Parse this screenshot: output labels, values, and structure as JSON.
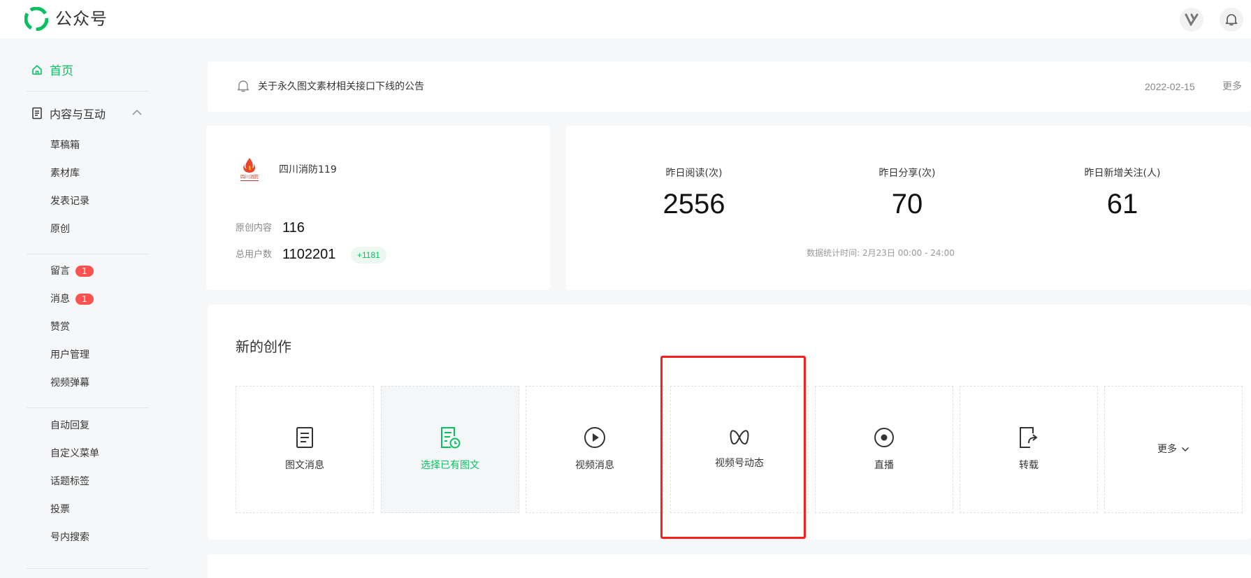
{
  "app": {
    "brand": "公众号"
  },
  "sidebar": {
    "home_label": "首页",
    "group_label": "内容与互动",
    "items_content": [
      "草稿箱",
      "素材库",
      "发表记录",
      "原创"
    ],
    "items_interact": [
      {
        "label": "留言",
        "badge": "1"
      },
      {
        "label": "消息",
        "badge": "1"
      },
      {
        "label": "赞赏"
      },
      {
        "label": "用户管理"
      },
      {
        "label": "视频弹幕"
      }
    ],
    "items_features": [
      "自动回复",
      "自定义菜单",
      "话题标签",
      "投票",
      "号内搜索"
    ]
  },
  "notice": {
    "text": "关于永久图文素材相关接口下线的公告",
    "date": "2022-02-15",
    "more": "更多"
  },
  "account": {
    "logo_text": "四川消防",
    "name": "四川消防119",
    "original_label": "原创内容",
    "original_value": "116",
    "users_label": "总用户数",
    "users_value": "1102201",
    "users_gain": "+1181"
  },
  "stats": {
    "items": [
      {
        "label": "昨日阅读(次)",
        "value": "2556"
      },
      {
        "label": "昨日分享(次)",
        "value": "70"
      },
      {
        "label": "昨日新增关注(人)",
        "value": "61"
      }
    ],
    "footnote": "数据统计时间: 2月23日 00:00 - 24:00"
  },
  "create": {
    "title": "新的创作",
    "tiles": [
      {
        "label": "图文消息",
        "icon": "article-icon"
      },
      {
        "label": "选择已有图文",
        "icon": "article-history-icon"
      },
      {
        "label": "视频消息",
        "icon": "play-circle-icon"
      },
      {
        "label": "视频号动态",
        "icon": "channels-icon"
      },
      {
        "label": "直播",
        "icon": "live-icon"
      },
      {
        "label": "转载",
        "icon": "repost-icon"
      },
      {
        "label": "更多",
        "icon": "chevron-down-icon"
      }
    ]
  },
  "colors": {
    "accent": "#07c160",
    "badge": "#fa5151",
    "highlight": "#ff1d1d"
  }
}
